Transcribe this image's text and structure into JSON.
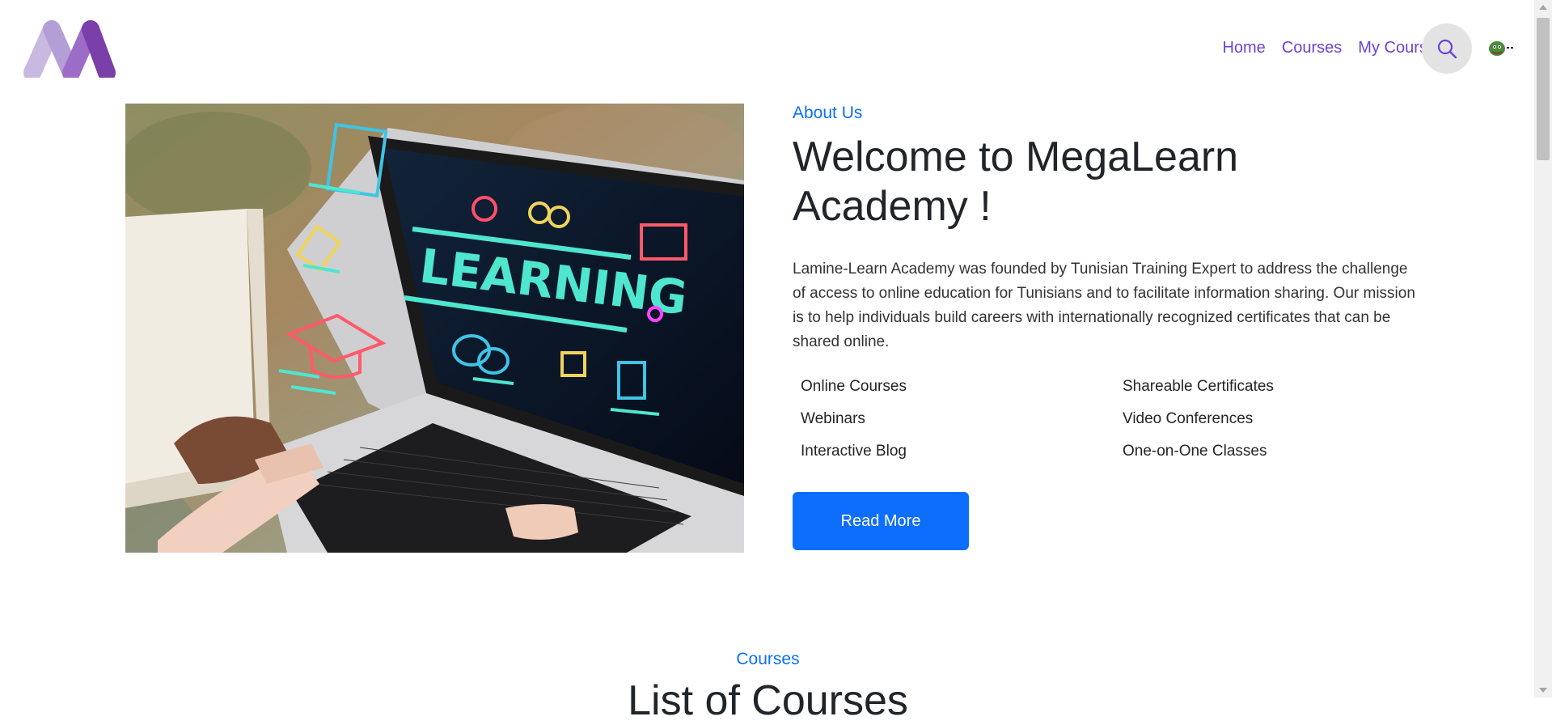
{
  "nav": {
    "logo_icon": "megalearn-m-logo",
    "links": [
      "Home",
      "Courses",
      "My Courses"
    ],
    "search_icon": "search-icon",
    "avatar_icon": "user-avatar-icon"
  },
  "about": {
    "eyebrow": "About Us",
    "title": "Welcome to MegaLearn Academy !",
    "description": "Lamine-Learn Academy was founded by Tunisian Training Expert to address the challenge of access to online education for Tunisians and to facilitate information sharing. Our mission is to help individuals build careers with internationally recognized certificates that can be shared online.",
    "features": [
      "Online Courses",
      "Shareable Certificates",
      "Webinars",
      "Video Conferences",
      "Interactive Blog",
      "One-on-One Classes"
    ],
    "button_label": "Read More",
    "image_text": "LEARNING"
  },
  "courses": {
    "eyebrow": "Courses",
    "title": "List of Courses"
  },
  "colors": {
    "accent": "#0d6efd",
    "nav_link": "#6a44d6",
    "logo_light": "#c9b8e0",
    "logo_dark": "#7a3fa8"
  }
}
